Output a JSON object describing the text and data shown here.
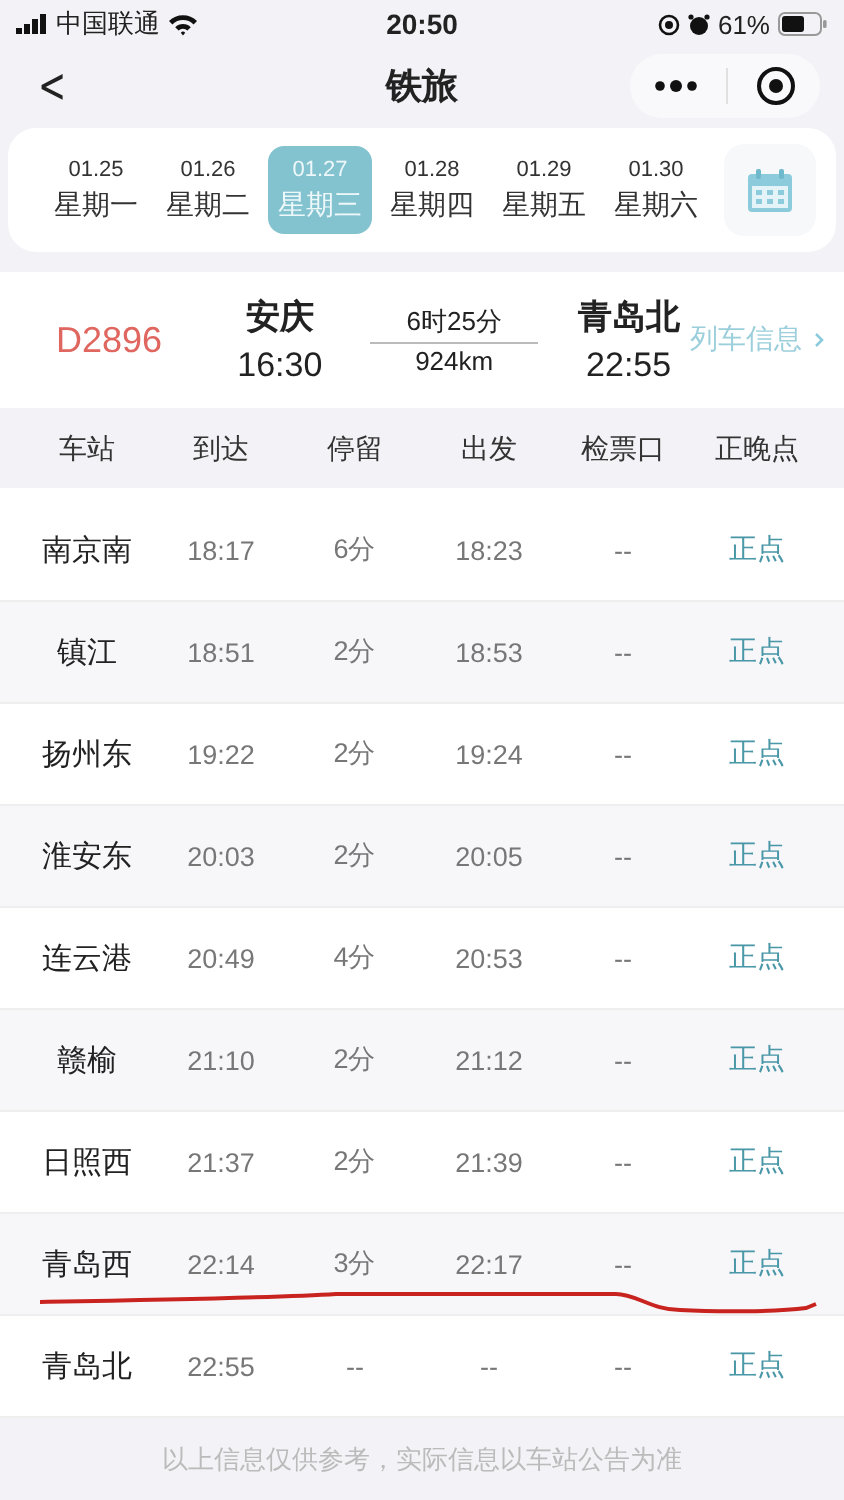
{
  "status_bar": {
    "carrier": "中国联通",
    "time": "20:50",
    "battery": "61%"
  },
  "nav": {
    "back": "<",
    "title": "铁旅"
  },
  "dates": [
    {
      "date": "01.25",
      "weekday": "星期一",
      "selected": false
    },
    {
      "date": "01.26",
      "weekday": "星期二",
      "selected": false
    },
    {
      "date": "01.27",
      "weekday": "星期三",
      "selected": true
    },
    {
      "date": "01.28",
      "weekday": "星期四",
      "selected": false
    },
    {
      "date": "01.29",
      "weekday": "星期五",
      "selected": false
    },
    {
      "date": "01.30",
      "weekday": "星期六",
      "selected": false
    }
  ],
  "train": {
    "number": "D2896",
    "from": "安庆",
    "depart": "16:30",
    "duration": "6时25分",
    "distance": "924km",
    "to": "青岛北",
    "arrive": "22:55",
    "info_link": "列车信息"
  },
  "table": {
    "columns": [
      "车站",
      "到达",
      "停留",
      "出发",
      "检票口",
      "正晚点"
    ],
    "rows": [
      {
        "station": "南京南",
        "arrive": "18:17",
        "stop": "6分",
        "depart": "18:23",
        "gate": "--",
        "status": "正点"
      },
      {
        "station": "镇江",
        "arrive": "18:51",
        "stop": "2分",
        "depart": "18:53",
        "gate": "--",
        "status": "正点"
      },
      {
        "station": "扬州东",
        "arrive": "19:22",
        "stop": "2分",
        "depart": "19:24",
        "gate": "--",
        "status": "正点"
      },
      {
        "station": "淮安东",
        "arrive": "20:03",
        "stop": "2分",
        "depart": "20:05",
        "gate": "--",
        "status": "正点"
      },
      {
        "station": "连云港",
        "arrive": "20:49",
        "stop": "4分",
        "depart": "20:53",
        "gate": "--",
        "status": "正点"
      },
      {
        "station": "赣榆",
        "arrive": "21:10",
        "stop": "2分",
        "depart": "21:12",
        "gate": "--",
        "status": "正点"
      },
      {
        "station": "日照西",
        "arrive": "21:37",
        "stop": "2分",
        "depart": "21:39",
        "gate": "--",
        "status": "正点"
      },
      {
        "station": "青岛西",
        "arrive": "22:14",
        "stop": "3分",
        "depart": "22:17",
        "gate": "--",
        "status": "正点"
      },
      {
        "station": "青岛北",
        "arrive": "22:55",
        "stop": "--",
        "depart": "--",
        "gate": "--",
        "status": "正点"
      }
    ]
  },
  "footer": "以上信息仅供参考，实际信息以车站公告为准"
}
